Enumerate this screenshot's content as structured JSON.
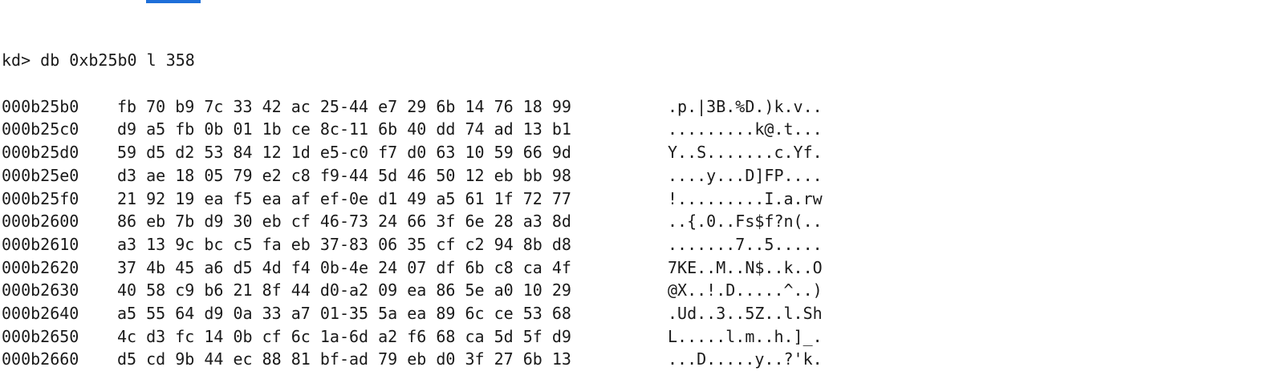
{
  "command": "kd> db 0xb25b0 l 358",
  "rows": [
    {
      "addr": "000b25b0",
      "bytes": "fb 70 b9 7c 33 42 ac 25-44 e7 29 6b 14 76 18 99",
      "ascii": ".p.|3B.%D.)k.v.."
    },
    {
      "addr": "000b25c0",
      "bytes": "d9 a5 fb 0b 01 1b ce 8c-11 6b 40 dd 74 ad 13 b1",
      "ascii": ".........k@.t..."
    },
    {
      "addr": "000b25d0",
      "bytes": "59 d5 d2 53 84 12 1d e5-c0 f7 d0 63 10 59 66 9d",
      "ascii": "Y..S.......c.Yf."
    },
    {
      "addr": "000b25e0",
      "bytes": "d3 ae 18 05 79 e2 c8 f9-44 5d 46 50 12 eb bb 98",
      "ascii": "....y...D]FP...."
    },
    {
      "addr": "000b25f0",
      "bytes": "21 92 19 ea f5 ea af ef-0e d1 49 a5 61 1f 72 77",
      "ascii": "!.........I.a.rw"
    },
    {
      "addr": "000b2600",
      "bytes": "86 eb 7b d9 30 eb cf 46-73 24 66 3f 6e 28 a3 8d",
      "ascii": "..{.0..Fs$f?n(.."
    },
    {
      "addr": "000b2610",
      "bytes": "a3 13 9c bc c5 fa eb 37-83 06 35 cf c2 94 8b d8",
      "ascii": ".......7..5....."
    },
    {
      "addr": "000b2620",
      "bytes": "37 4b 45 a6 d5 4d f4 0b-4e 24 07 df 6b c8 ca 4f",
      "ascii": "7KE..M..N$..k..O"
    },
    {
      "addr": "000b2630",
      "bytes": "40 58 c9 b6 21 8f 44 d0-a2 09 ea 86 5e a0 10 29",
      "ascii": "@X..!.D.....^..)"
    },
    {
      "addr": "000b2640",
      "bytes": "a5 55 64 d9 0a 33 a7 01-35 5a ea 89 6c ce 53 68",
      "ascii": ".Ud..3..5Z..l.Sh"
    },
    {
      "addr": "000b2650",
      "bytes": "4c d3 fc 14 0b cf 6c 1a-6d a2 f6 68 ca 5d 5f d9",
      "ascii": "L.....l.m..h.]_."
    },
    {
      "addr": "000b2660",
      "bytes": "d5 cd 9b 44 ec 88 81 bf-ad 79 eb d0 3f 27 6b 13",
      "ascii": "...D.....y..?'k."
    }
  ]
}
